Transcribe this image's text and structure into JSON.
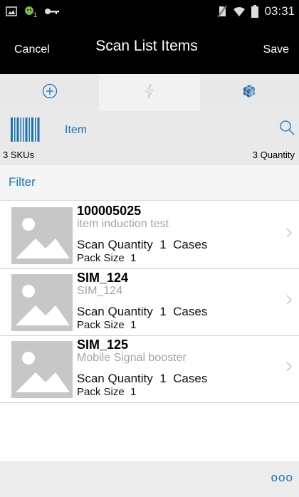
{
  "status_bar": {
    "time": "03:31",
    "icons": [
      "gallery-icon",
      "android-notification-icon",
      "key-icon",
      "no-sim-icon",
      "wifi-icon",
      "battery-icon"
    ]
  },
  "header": {
    "cancel_label": "Cancel",
    "title": "Scan List Items",
    "save_label": "Save"
  },
  "tabs": [
    {
      "icon": "add-circle-icon",
      "active": false
    },
    {
      "icon": "lightning-icon",
      "active": true
    },
    {
      "icon": "cube-icon",
      "active": false
    }
  ],
  "scan": {
    "label": "Item"
  },
  "summary": {
    "skus": "3 SKUs",
    "quantity": "3 Quantity"
  },
  "filter_label": "Filter",
  "items": [
    {
      "code": "100005025",
      "description": "item induction test",
      "scan_quantity": "Scan Quantity  1  Cases",
      "pack_size": "Pack Size  1"
    },
    {
      "code": "SIM_124",
      "description": "SIM_124",
      "scan_quantity": "Scan Quantity  1  Cases",
      "pack_size": "Pack Size  1"
    },
    {
      "code": "SIM_125",
      "description": "Mobile Signal booster",
      "scan_quantity": "Scan Quantity  1  Cases",
      "pack_size": "Pack Size  1"
    }
  ],
  "footer": {
    "more_label": "ooo"
  },
  "colors": {
    "accent": "#1a73b5",
    "header_bg": "#000000",
    "secondary_text": "#a3a3a3"
  }
}
